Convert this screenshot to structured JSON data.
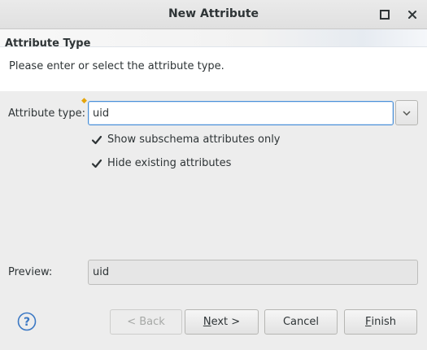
{
  "window": {
    "title": "New Attribute"
  },
  "header": {
    "title": "Attribute Type",
    "description": "Please enter or select the attribute type."
  },
  "form": {
    "attribute_type_label": "Attribute type:",
    "attribute_type_value": "uid",
    "required_marker": "◆",
    "show_subschema_label": "Show subschema attributes only",
    "show_subschema_checked": true,
    "hide_existing_label": "Hide existing attributes",
    "hide_existing_checked": true,
    "preview_label": "Preview:",
    "preview_value": "uid"
  },
  "buttons": {
    "back_label": "< Back",
    "next_mnemonic": "N",
    "next_rest": "ext >",
    "cancel_label": "Cancel",
    "finish_mnemonic": "F",
    "finish_rest": "inish"
  },
  "colors": {
    "focus_border": "#4a90d9",
    "help_icon": "#3b78c4",
    "required_marker": "#e5a50a"
  },
  "icons": {
    "maximize": "maximize-icon",
    "close": "close-icon",
    "dropdown": "chevron-down-icon",
    "help": "help-icon",
    "checkbox": "checkmark-icon"
  }
}
